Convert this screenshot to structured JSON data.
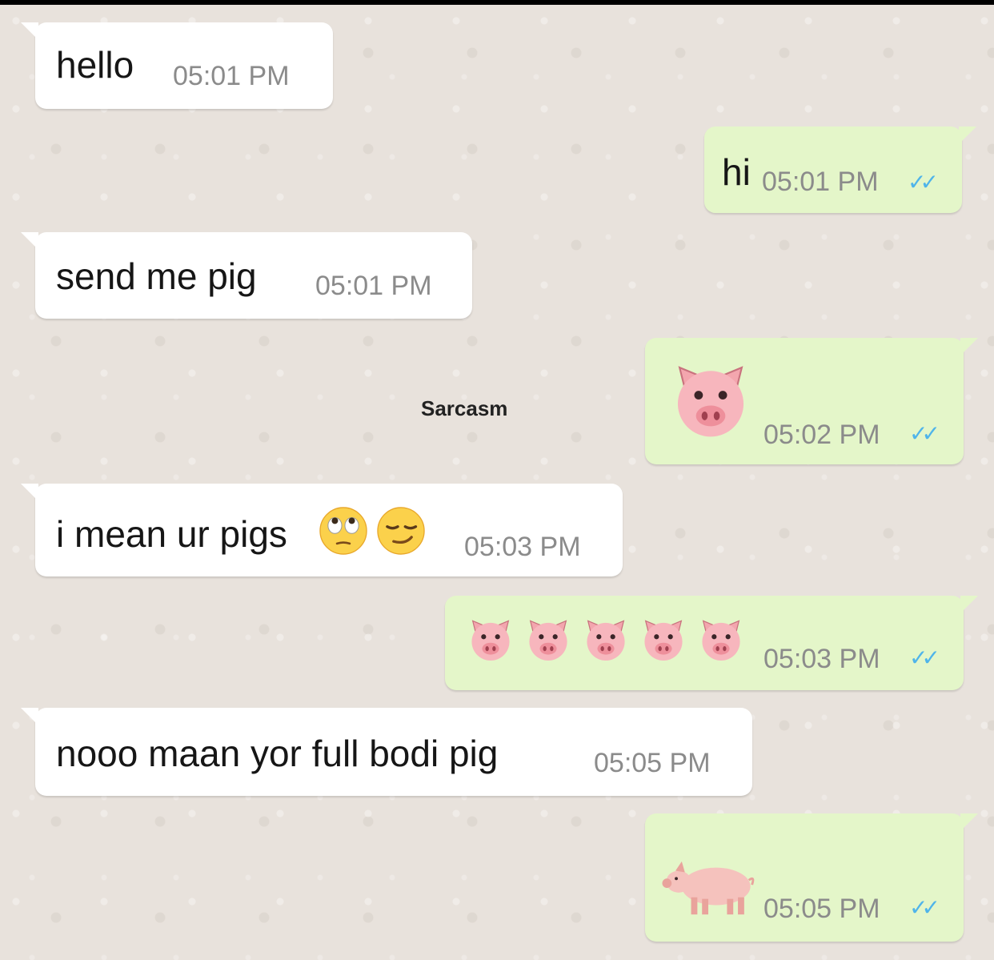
{
  "watermark": "Sarcasm",
  "messages": [
    {
      "dir": "in",
      "text": "hello",
      "time": "05:01 PM"
    },
    {
      "dir": "out",
      "text": "hi",
      "time": "05:01 PM",
      "status": "read"
    },
    {
      "dir": "in",
      "text": "send me pig",
      "time": "05:01 PM"
    },
    {
      "dir": "out",
      "emoji": "pig-face-icon",
      "time": "05:02 PM",
      "status": "read"
    },
    {
      "dir": "in",
      "text": "i mean ur pigs",
      "emoji": [
        "face-with-rolling-eyes-icon",
        "smirking-face-icon"
      ],
      "time": "05:03 PM"
    },
    {
      "dir": "out",
      "emoji": [
        "pig-face-icon",
        "pig-face-icon",
        "pig-face-icon",
        "pig-face-icon",
        "pig-face-icon"
      ],
      "time": "05:03 PM",
      "status": "read"
    },
    {
      "dir": "in",
      "text": "nooo maan yor full bodi pig",
      "time": "05:05 PM"
    },
    {
      "dir": "out",
      "emoji": "pig-icon",
      "time": "05:05 PM",
      "status": "read"
    }
  ],
  "colors": {
    "incoming_bubble": "#ffffff",
    "outgoing_bubble": "#e4f6c9",
    "read_ticks": "#4fb4ea",
    "chat_background": "#e8e2dc"
  }
}
